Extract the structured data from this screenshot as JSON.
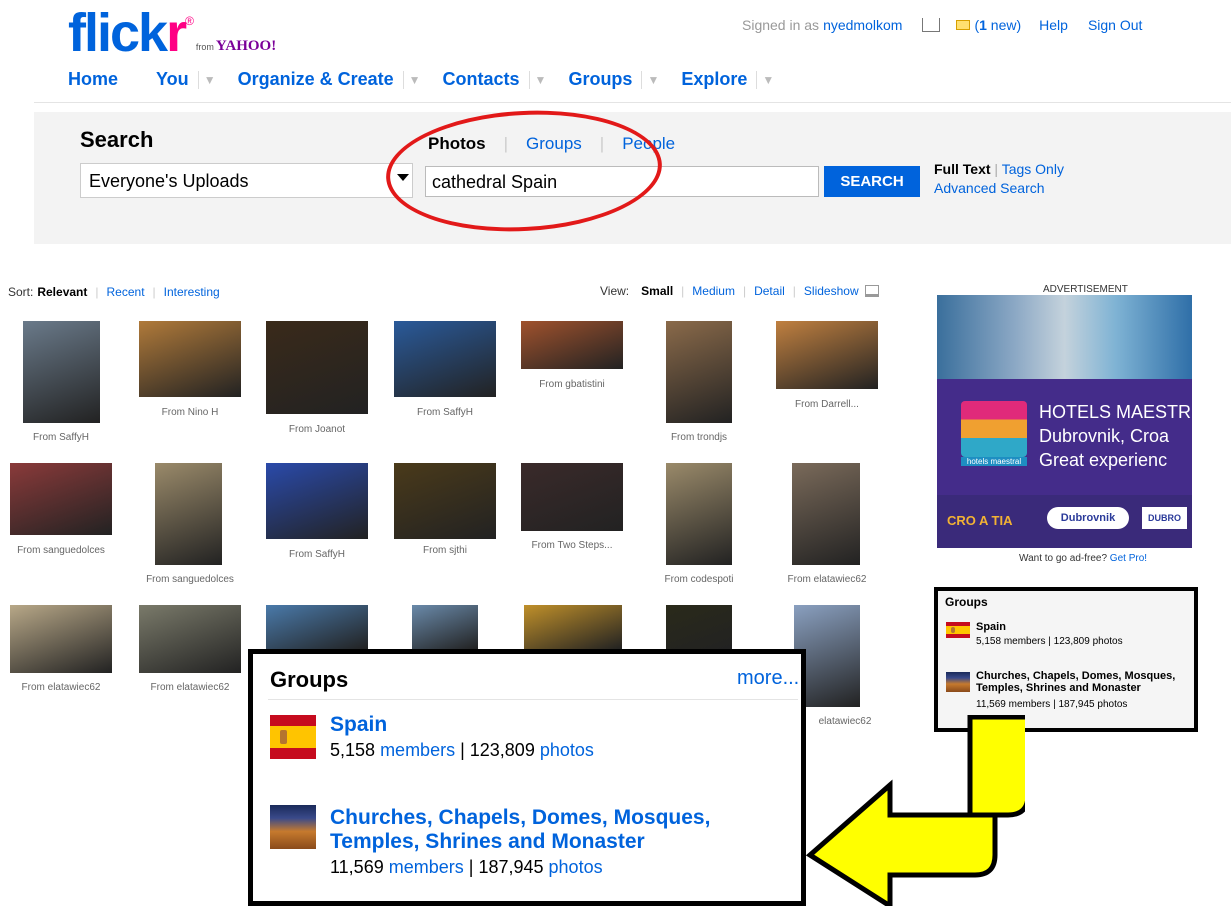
{
  "header": {
    "logo": {
      "flick": "flick",
      "r": "r",
      "reg": "®",
      "from": "from",
      "yahoo": "YAHOO!"
    },
    "signed_in_prefix": "Signed in as",
    "username": "nyedmolkom",
    "new_prefix": "(",
    "new_count": "1",
    "new_suffix": " new)",
    "help": "Help",
    "sign_out": "Sign Out"
  },
  "nav": {
    "home": "Home",
    "you": "You",
    "organize": "Organize & Create",
    "contacts": "Contacts",
    "groups": "Groups",
    "explore": "Explore",
    "caret": "▼"
  },
  "search": {
    "title": "Search",
    "scope": "Everyone's Uploads",
    "tabs": {
      "photos": "Photos",
      "groups": "Groups",
      "people": "People"
    },
    "query": "cathedral Spain",
    "button": "SEARCH",
    "full_text": "Full Text",
    "tags_only": "Tags Only",
    "advanced": "Advanced Search"
  },
  "results": {
    "sort_label": "Sort:",
    "sort_relevant": "Relevant",
    "sort_recent": "Recent",
    "sort_interesting": "Interesting",
    "view_label": "View:",
    "view_small": "Small",
    "view_medium": "Medium",
    "view_detail": "Detail",
    "view_slideshow": "Slideshow",
    "captions": [
      "From SaffyH",
      "From Nino H",
      "From Joanot",
      "From SaffyH",
      "From gbatistini",
      "From trondjs",
      "From Darrell...",
      "From sanguedolces",
      "From sanguedolces",
      "From SaffyH",
      "From sjthi",
      "From Two Steps...",
      "From codespoti",
      "From elatawiec62",
      "From elatawiec62",
      "From elatawiec62",
      "elatawiec62"
    ],
    "thumb_colors": [
      "#6a7a8a",
      "#b07a3a",
      "#3a2a1a",
      "#2a5a9a",
      "#a0522d",
      "#8a6a4a",
      "#c08040",
      "#8a3a3a",
      "#9a8a6a",
      "#2a4aaa",
      "#4a3a1a",
      "#3a2a2a",
      "#9a8a6a",
      "#7a6a5a",
      "#b8a888",
      "#7a7a6a",
      "#4a7aaa",
      "#6a8aaa",
      "#c0902a",
      "#2a2a1a",
      "#8aa0c0"
    ]
  },
  "ad": {
    "label": "ADVERTISEMENT",
    "line1": "HOTELS MAESTR",
    "line2": "Dubrovnik, Croa",
    "line3": "Great experienc",
    "logo_caption": "hotels maestral",
    "croatia": "CRO A TIA",
    "dubrovnik": "Dubrovnik",
    "dub2": "DUBRO",
    "adfree_text": "Want to go ad-free?",
    "get_pro": "Get Pro!"
  },
  "groups_panel": {
    "title": "Groups",
    "more": "more...",
    "items": [
      {
        "name": "Spain",
        "members_count": "5,158",
        "members": "members",
        "sep": " | ",
        "photos_count": "123,809",
        "photos": "photos"
      },
      {
        "name": "Churches, Chapels, Domes, Mosques, Temples, Shrines and Monaster",
        "members_count": "11,569",
        "members": "members",
        "sep": " | ",
        "photos_count": "187,945",
        "photos": "photos"
      }
    ]
  },
  "colors": {
    "brand_blue": "#0063dc",
    "brand_pink": "#ff0084",
    "highlight_red": "#e21919",
    "arrow_yellow": "#ffff00"
  }
}
